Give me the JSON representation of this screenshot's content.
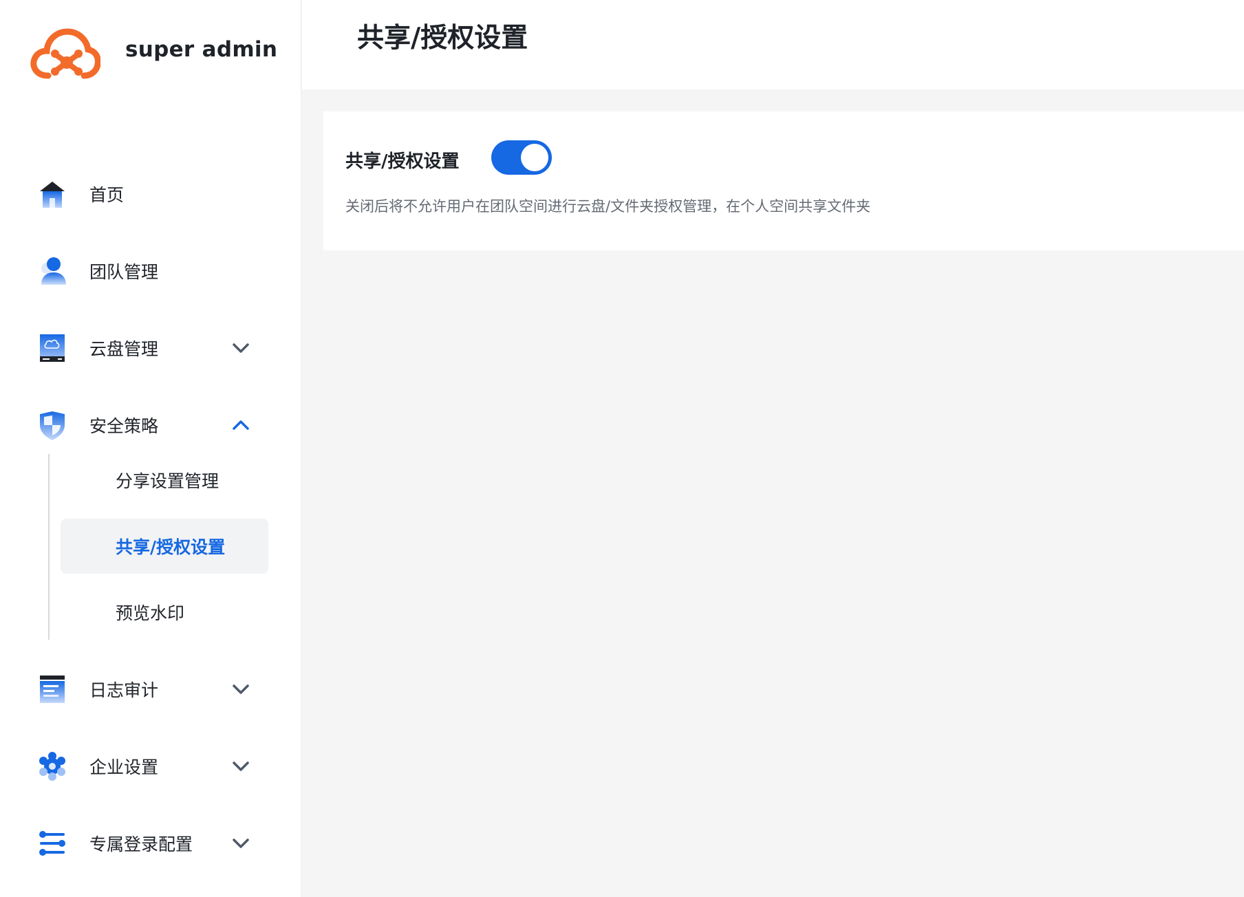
{
  "brand": {
    "name": "super admin"
  },
  "header": {
    "title": "共享/授权设置"
  },
  "sidebar": {
    "items": [
      {
        "label": "首页",
        "icon": "home-icon"
      },
      {
        "label": "团队管理",
        "icon": "user-icon"
      },
      {
        "label": "云盘管理",
        "icon": "cloud-drive-icon",
        "expanded": false
      },
      {
        "label": "安全策略",
        "icon": "shield-icon",
        "expanded": true
      },
      {
        "label": "日志审计",
        "icon": "log-icon",
        "expanded": false
      },
      {
        "label": "企业设置",
        "icon": "gear-icon",
        "expanded": false
      },
      {
        "label": "专属登录配置",
        "icon": "sliders-icon",
        "expanded": false
      }
    ],
    "security_submenu": [
      {
        "label": "分享设置管理",
        "active": false
      },
      {
        "label": "共享/授权设置",
        "active": true
      },
      {
        "label": "预览水印",
        "active": false
      }
    ]
  },
  "setting_card": {
    "title": "共享/授权设置",
    "enabled": true,
    "description": "关闭后将不允许用户在团队空间进行云盘/文件夹授权管理，在个人空间共享文件夹"
  },
  "colors": {
    "accent": "#1668e3",
    "brand_orange": "#f26b2a",
    "page_bg": "#f5f5f5"
  }
}
